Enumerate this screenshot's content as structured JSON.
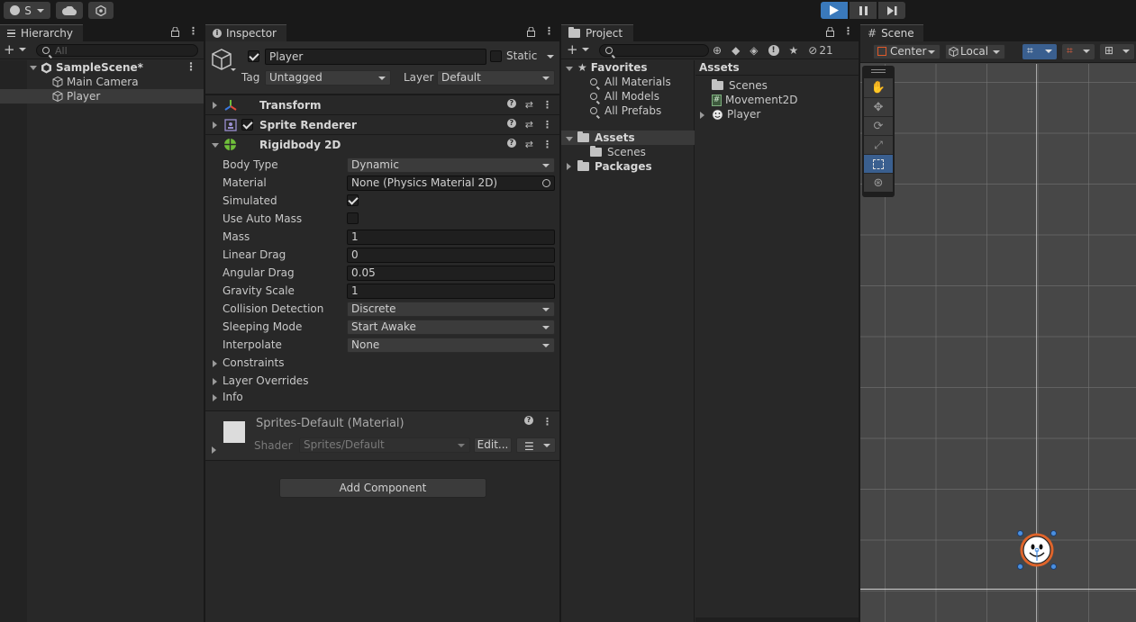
{
  "toolbar": {
    "account_label": "S",
    "play_color": "#3a79bb"
  },
  "hierarchy": {
    "tab_label": "Hierarchy",
    "search_placeholder": "All",
    "scene_name": "SampleScene*",
    "items": [
      {
        "label": "Main Camera"
      },
      {
        "label": "Player"
      }
    ]
  },
  "inspector": {
    "tab_label": "Inspector",
    "object_name": "Player",
    "static_label": "Static",
    "tag_label": "Tag",
    "tag_value": "Untagged",
    "layer_label": "Layer",
    "layer_value": "Default",
    "components": {
      "transform": "Transform",
      "sprite_renderer": "Sprite Renderer",
      "rigidbody": "Rigidbody 2D"
    },
    "rigidbody_fields": {
      "body_type_label": "Body Type",
      "body_type_value": "Dynamic",
      "material_label": "Material",
      "material_value": "None (Physics Material 2D)",
      "simulated_label": "Simulated",
      "use_auto_mass_label": "Use Auto Mass",
      "mass_label": "Mass",
      "mass_value": "1",
      "linear_drag_label": "Linear Drag",
      "linear_drag_value": "0",
      "angular_drag_label": "Angular Drag",
      "angular_drag_value": "0.05",
      "gravity_scale_label": "Gravity Scale",
      "gravity_scale_value": "1",
      "collision_detection_label": "Collision Detection",
      "collision_detection_value": "Discrete",
      "sleeping_mode_label": "Sleeping Mode",
      "sleeping_mode_value": "Start Awake",
      "interpolate_label": "Interpolate",
      "interpolate_value": "None",
      "constraints_label": "Constraints",
      "layer_overrides_label": "Layer Overrides",
      "info_label": "Info"
    },
    "material": {
      "name": "Sprites-Default (Material)",
      "shader_label": "Shader",
      "shader_value": "Sprites/Default",
      "edit_label": "Edit..."
    },
    "add_component_label": "Add Component"
  },
  "project": {
    "tab_label": "Project",
    "hidden_count": "21",
    "favorites_label": "Favorites",
    "favorites": [
      "All Materials",
      "All Models",
      "All Prefabs"
    ],
    "assets_label": "Assets",
    "assets_children": [
      "Scenes"
    ],
    "packages_label": "Packages",
    "assets_header": "Assets",
    "asset_items": [
      "Scenes",
      "Movement2D",
      "Player"
    ]
  },
  "scene": {
    "tab_label": "Scene",
    "pivot_label": "Center",
    "space_label": "Local"
  }
}
